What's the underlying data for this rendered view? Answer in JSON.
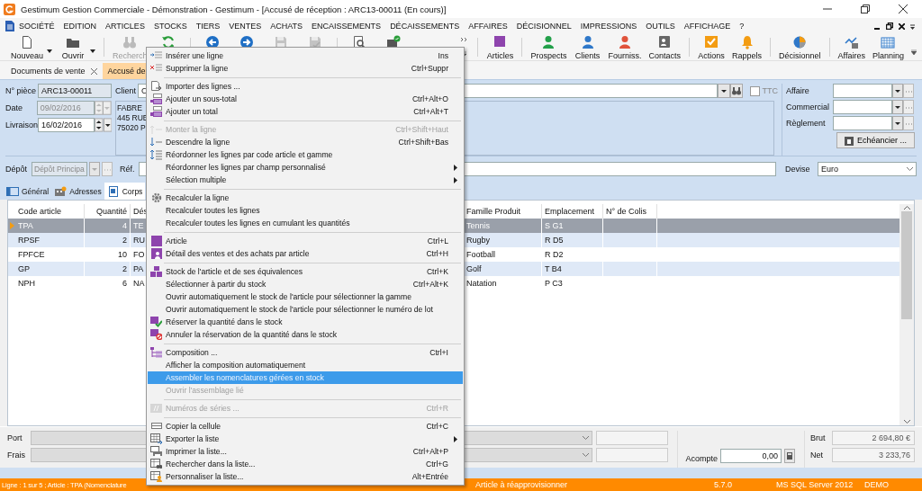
{
  "window": {
    "title": "Gestimum Gestion Commerciale - Démonstration - Gestimum - [Accusé de réception : ARC13-00011 (En cours)]"
  },
  "menu_bar": [
    "SOCIÉTÉ",
    "EDITION",
    "ARTICLES",
    "STOCKS",
    "TIERS",
    "VENTES",
    "ACHATS",
    "ENCAISSEMENTS",
    "DÉCAISSEMENTS",
    "AFFAIRES",
    "DÉCISIONNEL",
    "IMPRESSIONS",
    "OUTILS",
    "AFFICHAGE",
    "?"
  ],
  "toolbar": {
    "groups": [
      [
        {
          "label": "Nouveau",
          "dropdown": true,
          "disabled": false
        },
        {
          "label": "Ouvrir",
          "dropdown": true,
          "disabled": false
        }
      ],
      [
        {
          "label": "Recherch",
          "disabled": true
        },
        {
          "disabled": false
        }
      ],
      [
        {
          "disabled": false
        },
        {
          "disabled": false
        },
        {
          "disabled": true
        },
        {
          "disabled": true
        }
      ],
      [
        {
          "disabled": false
        },
        {
          "disabled": false
        }
      ]
    ],
    "shortcut_groups": [
      [
        {
          "label": "Articles"
        }
      ],
      [
        {
          "label": "Prospects"
        },
        {
          "label": "Clients"
        },
        {
          "label": "Fourniss."
        },
        {
          "label": "Contacts"
        }
      ],
      [
        {
          "label": "Actions"
        },
        {
          "label": "Rappels"
        }
      ],
      [
        {
          "label": "Décisionnel"
        }
      ],
      [
        {
          "label": "Affaires"
        },
        {
          "label": "Planning"
        }
      ]
    ]
  },
  "document_tabs": [
    {
      "label": "Documents de vente",
      "closable": true,
      "selected": false
    },
    {
      "label": "Accusé de",
      "closable": false,
      "selected": true
    }
  ],
  "form": {
    "piece": {
      "label": "N° pièce",
      "value": "ARC13-00011"
    },
    "date": {
      "label": "Date",
      "value": "09/02/2016",
      "disabled": true
    },
    "livraison": {
      "label": "Livraison",
      "value": "16/02/2016",
      "disabled": false
    },
    "client": {
      "label": "Client",
      "value": "C",
      "address": [
        "FABRE",
        "445 RUE",
        "75020 P"
      ]
    },
    "ttc": {
      "label": "TTC",
      "checked": false
    },
    "right_fields": [
      {
        "label": "Affaire"
      },
      {
        "label": "Commercial"
      },
      {
        "label": "Règlement"
      }
    ],
    "echeancier_button": "Echéancier ...",
    "depot": {
      "label": "Dépôt",
      "value": "Dépôt Principa",
      "disabled": true
    },
    "ref": {
      "label": "Réf."
    },
    "devise": {
      "label": "Devise",
      "value": "Euro"
    }
  },
  "section_tabs": [
    {
      "label": "Général",
      "selected": false
    },
    {
      "label": "Adresses",
      "selected": false
    },
    {
      "label": "Corps",
      "selected": true
    }
  ],
  "table": {
    "columns": [
      "Code article",
      "Quantité",
      "Dés",
      "Famille Produit",
      "Emplacement",
      "N° de Colis"
    ],
    "rows": [
      {
        "code": "TPA",
        "quantite": "4",
        "designation": "TE",
        "famille": "Tennis",
        "emplacement": "S G1",
        "selected": true
      },
      {
        "code": "RPSF",
        "quantite": "2",
        "designation": "RU",
        "famille": "Rugby",
        "emplacement": "R D5",
        "selected": false
      },
      {
        "code": "FPFCE",
        "quantite": "10",
        "designation": "FO",
        "famille": "Football",
        "emplacement": "R D2",
        "selected": false
      },
      {
        "code": "GP",
        "quantite": "2",
        "designation": "PA",
        "famille": "Golf",
        "emplacement": "T B4",
        "selected": false
      },
      {
        "code": "NPH",
        "quantite": "6",
        "designation": "NA",
        "famille": "Natation",
        "emplacement": "P C3",
        "selected": false
      }
    ]
  },
  "footer": {
    "port": {
      "label": "Port"
    },
    "frais": {
      "label": "Frais"
    },
    "acompte": {
      "label": "Acompte",
      "value": "0,00"
    },
    "brut": {
      "label": "Brut",
      "value": "2 694,80 €"
    },
    "net": {
      "label": "Net",
      "value": "3 233,76"
    }
  },
  "status_bar": {
    "left": "Ligne : 1 sur 5 ; Article : TPA (Nomenclature",
    "message": "Article à réapprovisionner",
    "version": "5.7.0",
    "server": "MS SQL Server 2012",
    "mode": "DEMO"
  },
  "context_menu": {
    "items": [
      {
        "kind": "item",
        "label": "Insérer une ligne",
        "shortcut": "Ins",
        "disabled": false,
        "selected": false
      },
      {
        "kind": "item",
        "label": "Supprimer la ligne",
        "shortcut": "Ctrl+Suppr",
        "disabled": false,
        "selected": false
      },
      {
        "kind": "separator"
      },
      {
        "kind": "item",
        "label": "Importer des lignes ...",
        "disabled": false,
        "selected": false
      },
      {
        "kind": "item",
        "label": "Ajouter un sous-total",
        "shortcut": "Ctrl+Alt+O",
        "disabled": false,
        "selected": false
      },
      {
        "kind": "item",
        "label": "Ajouter un total",
        "shortcut": "Ctrl+Alt+T",
        "disabled": false,
        "selected": false
      },
      {
        "kind": "separator"
      },
      {
        "kind": "item",
        "label": "Monter la ligne",
        "shortcut": "Ctrl+Shift+Haut",
        "disabled": true,
        "selected": false
      },
      {
        "kind": "item",
        "label": "Descendre la ligne",
        "shortcut": "Ctrl+Shift+Bas",
        "disabled": false,
        "selected": false
      },
      {
        "kind": "item",
        "label": "Réordonner les lignes par code article et gamme",
        "disabled": false,
        "selected": false
      },
      {
        "kind": "item",
        "label": "Réordonner les lignes par champ personnalisé",
        "submenu": true,
        "disabled": false,
        "selected": false
      },
      {
        "kind": "item",
        "label": "Sélection multiple",
        "submenu": true,
        "disabled": false,
        "selected": false
      },
      {
        "kind": "separator"
      },
      {
        "kind": "item",
        "label": "Recalculer la ligne",
        "disabled": false,
        "selected": false
      },
      {
        "kind": "item",
        "label": "Recalculer toutes les lignes",
        "disabled": false,
        "selected": false
      },
      {
        "kind": "item",
        "label": "Recalculer toutes les lignes en cumulant les quantités",
        "disabled": false,
        "selected": false
      },
      {
        "kind": "separator"
      },
      {
        "kind": "item",
        "label": "Article",
        "shortcut": "Ctrl+L",
        "disabled": false,
        "selected": false
      },
      {
        "kind": "item",
        "label": "Détail des ventes et des achats par article",
        "shortcut": "Ctrl+H",
        "disabled": false,
        "selected": false
      },
      {
        "kind": "separator"
      },
      {
        "kind": "item",
        "label": "Stock de l'article et de ses équivalences",
        "shortcut": "Ctrl+K",
        "disabled": false,
        "selected": false
      },
      {
        "kind": "item",
        "label": "Sélectionner à partir du stock",
        "shortcut": "Ctrl+Alt+K",
        "disabled": false,
        "selected": false
      },
      {
        "kind": "item",
        "label": "Ouvrir automatiquement le stock de l'article pour sélectionner la gamme",
        "disabled": false,
        "selected": false
      },
      {
        "kind": "item",
        "label": "Ouvrir automatiquement le stock de l'article pour sélectionner le numéro de lot",
        "disabled": false,
        "selected": false
      },
      {
        "kind": "item",
        "label": "Réserver la quantité dans le stock",
        "disabled": false,
        "selected": false
      },
      {
        "kind": "item",
        "label": "Annuler la réservation de la quantité dans le stock",
        "disabled": false,
        "selected": false
      },
      {
        "kind": "separator"
      },
      {
        "kind": "item",
        "label": "Composition ...",
        "shortcut": "Ctrl+I",
        "disabled": false,
        "selected": false
      },
      {
        "kind": "item",
        "label": "Afficher la composition automatiquement",
        "disabled": false,
        "selected": false
      },
      {
        "kind": "item",
        "label": "Assembler les nomenclatures gérées en stock",
        "disabled": false,
        "selected": true
      },
      {
        "kind": "item",
        "label": "Ouvrir l'assemblage lié",
        "disabled": true,
        "selected": false
      },
      {
        "kind": "separator"
      },
      {
        "kind": "item",
        "label": "Numéros de séries ...",
        "shortcut": "Ctrl+R",
        "disabled": true,
        "selected": false
      },
      {
        "kind": "separator"
      },
      {
        "kind": "item",
        "label": "Copier la cellule",
        "shortcut": "Ctrl+C",
        "disabled": false,
        "selected": false
      },
      {
        "kind": "item",
        "label": "Exporter la liste",
        "submenu": true,
        "disabled": false,
        "selected": false
      },
      {
        "kind": "item",
        "label": "Imprimer la liste...",
        "shortcut": "Ctrl+Alt+P",
        "disabled": false,
        "selected": false
      },
      {
        "kind": "item",
        "label": "Rechercher dans la liste...",
        "shortcut": "Ctrl+G",
        "disabled": false,
        "selected": false
      },
      {
        "kind": "item",
        "label": "Personnaliser la liste...",
        "shortcut": "Alt+Entrée",
        "disabled": false,
        "selected": false
      }
    ]
  }
}
